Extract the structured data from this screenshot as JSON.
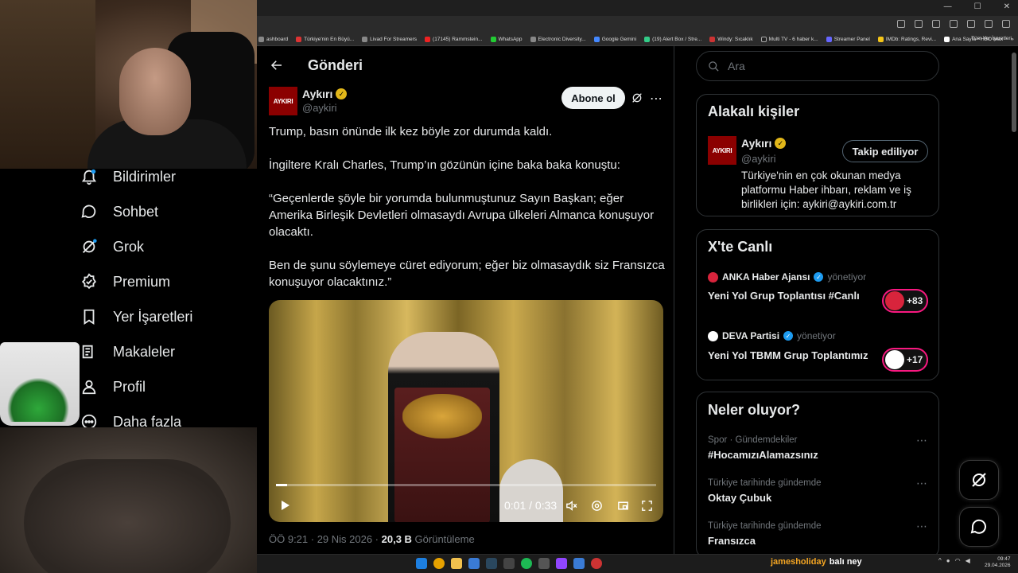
{
  "left_nav": {
    "items": [
      {
        "label": "Bildirimler",
        "icon": "bell-icon",
        "badge": true
      },
      {
        "label": "Sohbet",
        "icon": "chat-icon"
      },
      {
        "label": "Grok",
        "icon": "grok-icon",
        "badge": true
      },
      {
        "label": "Premium",
        "icon": "premium-icon"
      },
      {
        "label": "Yer İşaretleri",
        "icon": "bookmark-icon"
      },
      {
        "label": "Makaleler",
        "icon": "article-icon"
      },
      {
        "label": "Profil",
        "icon": "person-icon"
      },
      {
        "label": "Daha fazla",
        "icon": "more-circle-icon"
      }
    ]
  },
  "browser": {
    "bookmarks": [
      "ashboard",
      "Türkiye'nin En Büyü...",
      "Livad For Streamers",
      "(17145) Rammstein...",
      "WhatsApp",
      "Electronic Diversity...",
      "Google Gemini",
      "(19) Alert Box / Stre...",
      "Windy: Sıcaklık",
      "Multi TV - 6 haber k...",
      "Streamer Panel",
      "IMDb: Ratings, Revi...",
      "Ana Sayfa • HBO Max",
      "»"
    ],
    "all_bookmarks": "Tüm Yer İşaretleri"
  },
  "post": {
    "header_title": "Gönderi",
    "author_name": "Aykırı",
    "author_handle": "@aykiri",
    "avatar_text": "AYKIRI",
    "follow_label": "Abone ol",
    "paragraphs": [
      "Trump, basın önünde ilk kez böyle zor durumda kaldı.",
      "İngiltere Kralı Charles, Trump’ın gözünün içine baka baka konuştu:",
      "“Geçenlerde şöyle bir yorumda bulunmuştunuz Sayın Başkan; eğer Amerika Birleşik Devletleri olmasaydı Avrupa ülkeleri Almanca konuşuyor olacaktı.",
      "Ben de şunu söylemeye cüret ediyorum; eğer biz olmasaydık siz Fransızca konuşuyor olacaktınız.”"
    ],
    "video": {
      "time": "0:01 / 0:33",
      "progress": 0.03
    },
    "meta_time": "ÖÖ 9:21 · 29 Nis 2026 · ",
    "meta_views": "20,3 B",
    "meta_views_label": " Görüntüleme"
  },
  "sidebar": {
    "search_placeholder": "Ara",
    "related": {
      "title": "Alakalı kişiler",
      "name": "Aykırı",
      "handle": "@aykiri",
      "avatar_text": "AYKIRI",
      "bio": "Türkiye'nin en çok okunan medya platformu Haber ihbarı, reklam ve iş birlikleri için: aykiri@aykiri.com.tr",
      "button": "Takip ediliyor"
    },
    "live": {
      "title": "X'te Canlı",
      "items": [
        {
          "host": "ANKA Haber Ajansı",
          "sub": "yönetiyor",
          "title": "Yeni Yol Grup Toplantısı #Canlı",
          "count": "+83",
          "color": "#d8243c"
        },
        {
          "host": "DEVA Partisi",
          "sub": "yönetiyor",
          "title": "Yeni Yol TBMM Grup Toplantımız",
          "count": "+17",
          "color": "#1c6fb8"
        }
      ]
    },
    "trends": {
      "title": "Neler oluyor?",
      "items": [
        {
          "context": "Spor · Gündemdekiler",
          "name": "#HocamızıAlamazsınız"
        },
        {
          "context": "Türkiye tarihinde gündemde",
          "name": "Oktay Çubuk"
        },
        {
          "context": "Türkiye tarihinde gündemde",
          "name": "Fransızca"
        }
      ]
    }
  },
  "stream_chat": {
    "user": "jamesholiday",
    "message": "balı ney"
  },
  "clock": {
    "time": "09:47",
    "date": "29.04.2026"
  },
  "colors": {
    "accent": "#1d9bf0",
    "gold_verified": "#e2b719",
    "live": "#f91880",
    "brand": "#8b0000"
  }
}
